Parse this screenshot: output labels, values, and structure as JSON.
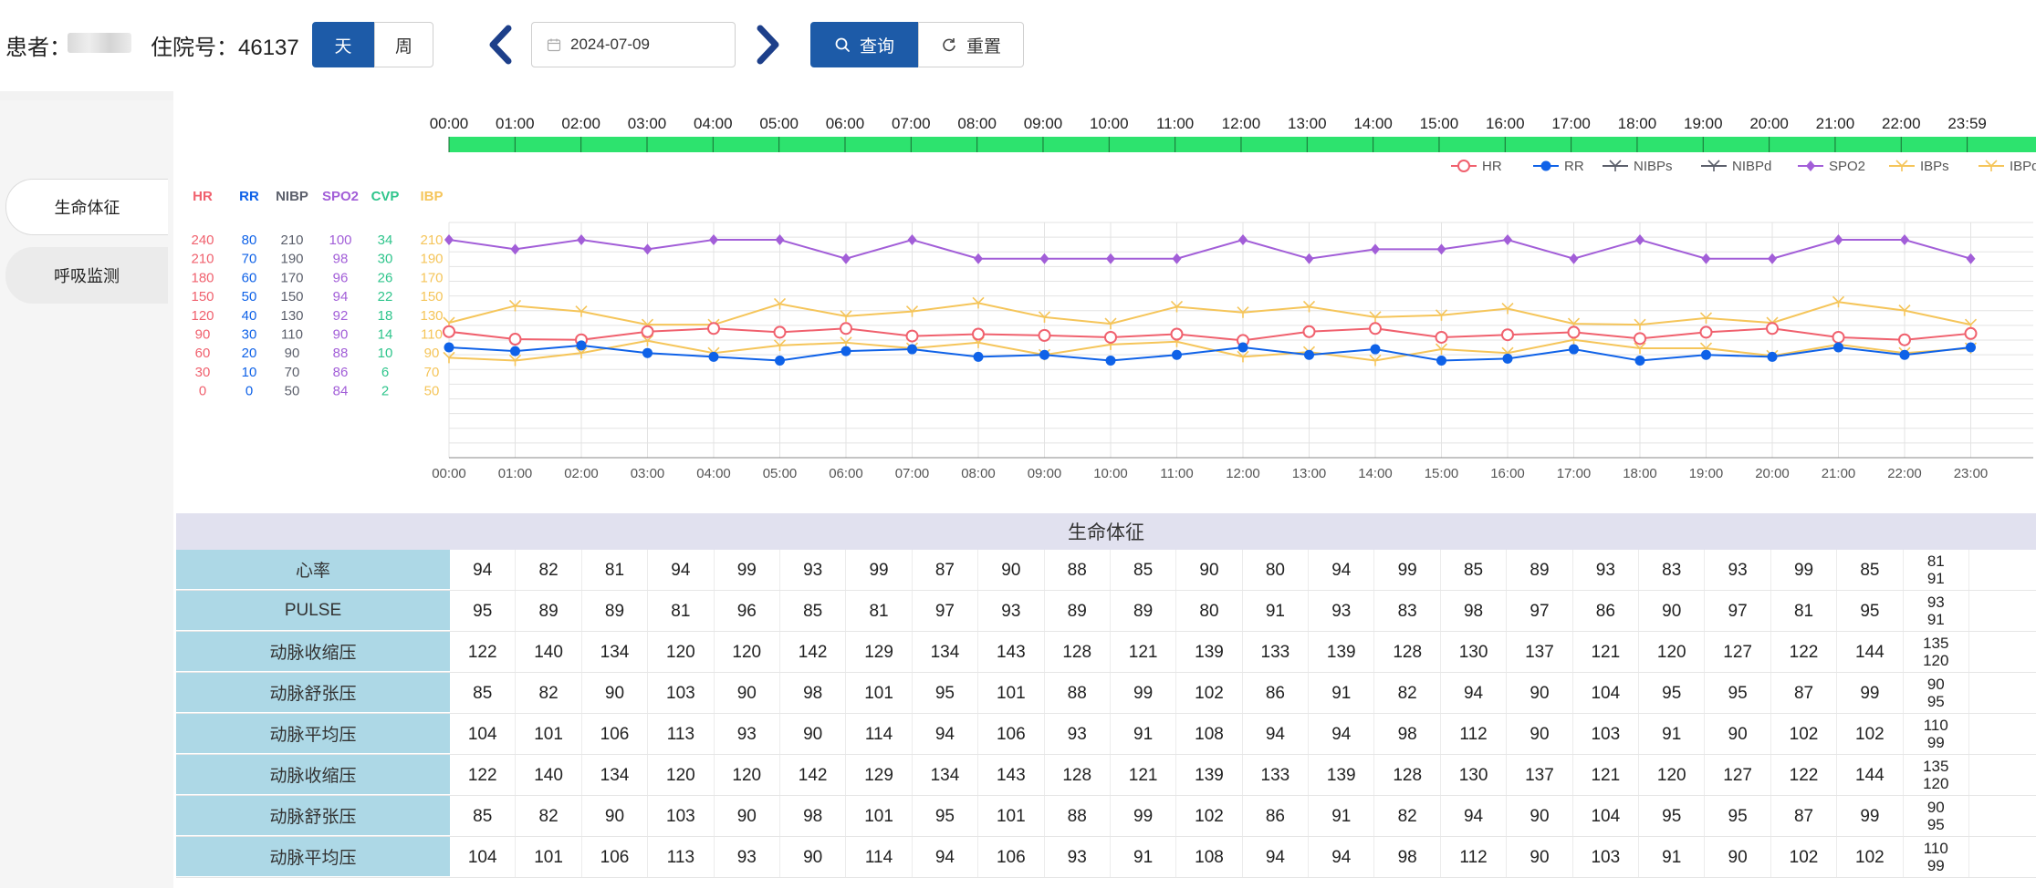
{
  "toolbar": {
    "patient_label": "患者：",
    "inpatient_label": "住院号：46137",
    "day_label": "天",
    "week_label": "周",
    "date": "2024-07-09",
    "query_label": "查询",
    "reset_label": "重置"
  },
  "sidebar": {
    "items": [
      {
        "label": "生命体征"
      },
      {
        "label": "呼吸监测"
      }
    ]
  },
  "colors": {
    "primary": "#1d5ba8",
    "timeline_bar": "#2de36e",
    "hr": "#f0616e",
    "rr": "#0f62e8",
    "nibp": "#5b5f6b",
    "spo2": "#a25ed8",
    "cvp": "#2fc58c",
    "ibp": "#f5c55a",
    "row_label_bg": "#add8e6",
    "table_title_bg": "#e1e1ef"
  },
  "chart_data": {
    "type": "line",
    "timeline_labels": [
      "00:00",
      "01:00",
      "02:00",
      "03:00",
      "04:00",
      "05:00",
      "06:00",
      "07:00",
      "08:00",
      "09:00",
      "10:00",
      "11:00",
      "12:00",
      "13:00",
      "14:00",
      "15:00",
      "16:00",
      "17:00",
      "18:00",
      "19:00",
      "20:00",
      "21:00",
      "22:00",
      "23:59"
    ],
    "x": [
      "00:00",
      "01:00",
      "02:00",
      "03:00",
      "04:00",
      "05:00",
      "06:00",
      "07:00",
      "08:00",
      "09:00",
      "10:00",
      "11:00",
      "12:00",
      "13:00",
      "14:00",
      "15:00",
      "16:00",
      "17:00",
      "18:00",
      "19:00",
      "20:00",
      "21:00",
      "22:00",
      "23:00"
    ],
    "legend_position": "top-right",
    "legend": [
      "HR",
      "RR",
      "NIBPs",
      "NIBPd",
      "SPO2",
      "IBPs",
      "IBPd"
    ],
    "axes": [
      {
        "name": "HR",
        "color": "#f0616e",
        "ticks": [
          240,
          210,
          180,
          150,
          120,
          90,
          60,
          30,
          0
        ]
      },
      {
        "name": "RR",
        "color": "#0f62e8",
        "ticks": [
          80,
          70,
          60,
          50,
          40,
          30,
          20,
          10,
          0
        ]
      },
      {
        "name": "NIBP",
        "color": "#5b5f6b",
        "ticks": [
          210,
          190,
          170,
          150,
          130,
          110,
          90,
          70,
          50
        ]
      },
      {
        "name": "SPO2",
        "color": "#a25ed8",
        "ticks": [
          100,
          98,
          96,
          94,
          92,
          90,
          88,
          86,
          84
        ]
      },
      {
        "name": "CVP",
        "color": "#2fc58c",
        "ticks": [
          34,
          30,
          26,
          22,
          18,
          14,
          10,
          6,
          2
        ]
      },
      {
        "name": "IBP",
        "color": "#f5c55a",
        "ticks": [
          210,
          190,
          170,
          150,
          130,
          110,
          90,
          70,
          50
        ]
      }
    ],
    "series": [
      {
        "name": "SPO2",
        "axis": 3,
        "color": "#a25ed8",
        "marker": "diamond",
        "values": [
          100,
          99,
          100,
          99,
          100,
          100,
          98,
          100,
          98,
          98,
          98,
          98,
          100,
          98,
          99,
          99,
          100,
          98,
          100,
          98,
          98,
          100,
          100,
          98
        ]
      },
      {
        "name": "IBPs",
        "axis": 5,
        "color": "#f5c55a",
        "marker": "y",
        "values": [
          122,
          140,
          134,
          120,
          120,
          142,
          129,
          134,
          143,
          128,
          121,
          139,
          133,
          139,
          128,
          130,
          137,
          121,
          120,
          127,
          122,
          144,
          135,
          120
        ]
      },
      {
        "name": "IBPd",
        "axis": 5,
        "color": "#f5c55a",
        "marker": "y",
        "values": [
          85,
          82,
          90,
          103,
          90,
          98,
          101,
          95,
          101,
          88,
          99,
          102,
          86,
          91,
          82,
          94,
          90,
          104,
          95,
          95,
          87,
          99,
          90,
          95
        ]
      },
      {
        "name": "HR",
        "axis": 0,
        "color": "#f0616e",
        "marker": "circle",
        "values": [
          94,
          82,
          81,
          94,
          99,
          93,
          99,
          87,
          90,
          88,
          85,
          90,
          80,
          94,
          99,
          85,
          89,
          93,
          83,
          93,
          99,
          85,
          81,
          91
        ]
      },
      {
        "name": "RR",
        "axis": 1,
        "color": "#0f62e8",
        "marker": "dot",
        "values": [
          23,
          21,
          24,
          20,
          18,
          16,
          21,
          22,
          18,
          19,
          16,
          19,
          23,
          19,
          22,
          16,
          17,
          22,
          16,
          19,
          18,
          23,
          19,
          23
        ]
      }
    ]
  },
  "table": {
    "title": "生命体征",
    "rows": [
      {
        "label": "心率",
        "values": [
          "94",
          "82",
          "81",
          "94",
          "99",
          "93",
          "99",
          "87",
          "90",
          "88",
          "85",
          "90",
          "80",
          "94",
          "99",
          "85",
          "89",
          "93",
          "83",
          "93",
          "99",
          "85"
        ],
        "last": [
          "81",
          "91"
        ]
      },
      {
        "label": "PULSE",
        "values": [
          "95",
          "89",
          "89",
          "81",
          "96",
          "85",
          "81",
          "97",
          "93",
          "89",
          "89",
          "80",
          "91",
          "93",
          "83",
          "98",
          "97",
          "86",
          "90",
          "97",
          "81",
          "95"
        ],
        "last": [
          "93",
          "91"
        ]
      },
      {
        "label": "动脉收缩压",
        "values": [
          "122",
          "140",
          "134",
          "120",
          "120",
          "142",
          "129",
          "134",
          "143",
          "128",
          "121",
          "139",
          "133",
          "139",
          "128",
          "130",
          "137",
          "121",
          "120",
          "127",
          "122",
          "144"
        ],
        "last": [
          "135",
          "120"
        ]
      },
      {
        "label": "动脉舒张压",
        "values": [
          "85",
          "82",
          "90",
          "103",
          "90",
          "98",
          "101",
          "95",
          "101",
          "88",
          "99",
          "102",
          "86",
          "91",
          "82",
          "94",
          "90",
          "104",
          "95",
          "95",
          "87",
          "99"
        ],
        "last": [
          "90",
          "95"
        ]
      },
      {
        "label": "动脉平均压",
        "values": [
          "104",
          "101",
          "106",
          "113",
          "93",
          "90",
          "114",
          "94",
          "106",
          "93",
          "91",
          "108",
          "94",
          "94",
          "98",
          "112",
          "90",
          "103",
          "91",
          "90",
          "102",
          "102"
        ],
        "last": [
          "110",
          "99"
        ]
      },
      {
        "label": "动脉收缩压",
        "values": [
          "122",
          "140",
          "134",
          "120",
          "120",
          "142",
          "129",
          "134",
          "143",
          "128",
          "121",
          "139",
          "133",
          "139",
          "128",
          "130",
          "137",
          "121",
          "120",
          "127",
          "122",
          "144"
        ],
        "last": [
          "135",
          "120"
        ]
      },
      {
        "label": "动脉舒张压",
        "values": [
          "85",
          "82",
          "90",
          "103",
          "90",
          "98",
          "101",
          "95",
          "101",
          "88",
          "99",
          "102",
          "86",
          "91",
          "82",
          "94",
          "90",
          "104",
          "95",
          "95",
          "87",
          "99"
        ],
        "last": [
          "90",
          "95"
        ]
      },
      {
        "label": "动脉平均压",
        "values": [
          "104",
          "101",
          "106",
          "113",
          "93",
          "90",
          "114",
          "94",
          "106",
          "93",
          "91",
          "108",
          "94",
          "94",
          "98",
          "112",
          "90",
          "103",
          "91",
          "90",
          "102",
          "102"
        ],
        "last": [
          "110",
          "99"
        ]
      }
    ]
  }
}
